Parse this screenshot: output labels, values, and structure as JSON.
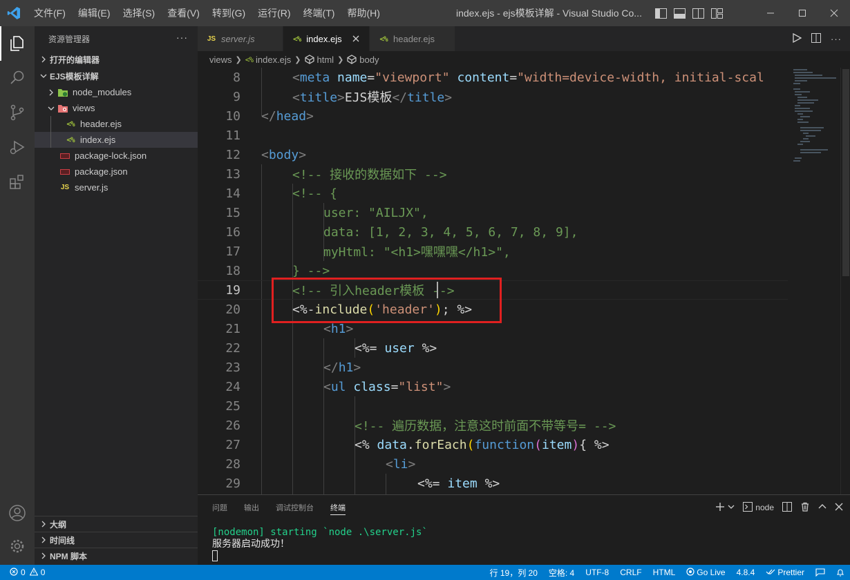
{
  "window": {
    "title": "index.ejs - ejs模板详解 - Visual Studio Co...",
    "menu": [
      "文件(F)",
      "编辑(E)",
      "选择(S)",
      "查看(V)",
      "转到(G)",
      "运行(R)",
      "终端(T)",
      "帮助(H)"
    ]
  },
  "sidebar": {
    "header": "资源管理器",
    "open_editors": "打开的编辑器",
    "project": "EJS模板详解",
    "tree": [
      {
        "name": "node_modules",
        "type": "folder-node"
      },
      {
        "name": "views",
        "type": "folder-views"
      },
      {
        "name": "header.ejs",
        "type": "ejs"
      },
      {
        "name": "index.ejs",
        "type": "ejs"
      },
      {
        "name": "package-lock.json",
        "type": "json"
      },
      {
        "name": "package.json",
        "type": "json"
      },
      {
        "name": "server.js",
        "type": "js"
      }
    ],
    "outline": "大纲",
    "timeline": "时间线",
    "npm": "NPM 脚本"
  },
  "tabs": [
    {
      "label": "server.js",
      "icon": "JS"
    },
    {
      "label": "index.ejs",
      "icon": "<%"
    },
    {
      "label": "header.ejs",
      "icon": "<%"
    }
  ],
  "breadcrumbs": [
    "views",
    "index.ejs",
    "html",
    "body"
  ],
  "code": {
    "line_numbers": [
      "8",
      "9",
      "10",
      "11",
      "12",
      "13",
      "14",
      "15",
      "16",
      "17",
      "18",
      "19",
      "20",
      "21",
      "22",
      "23",
      "24",
      "25",
      "26",
      "27",
      "28",
      "29"
    ],
    "active_line": "19"
  },
  "panel": {
    "tabs": [
      "问题",
      "输出",
      "调试控制台",
      "终端"
    ],
    "terminal_name": "node",
    "lines": [
      "[nodemon] starting `node .\\server.js`",
      "服务器启动成功！"
    ]
  },
  "statusbar": {
    "errors": "0",
    "warnings": "0",
    "position": "行 19，列 20",
    "spaces": "空格: 4",
    "encoding": "UTF-8",
    "eol": "CRLF",
    "language": "HTML",
    "golive": "Go Live",
    "version": "4.8.4",
    "prettier": "Prettier"
  },
  "colors": {
    "accent": "#007acc",
    "highlight_box": "#e02020"
  }
}
